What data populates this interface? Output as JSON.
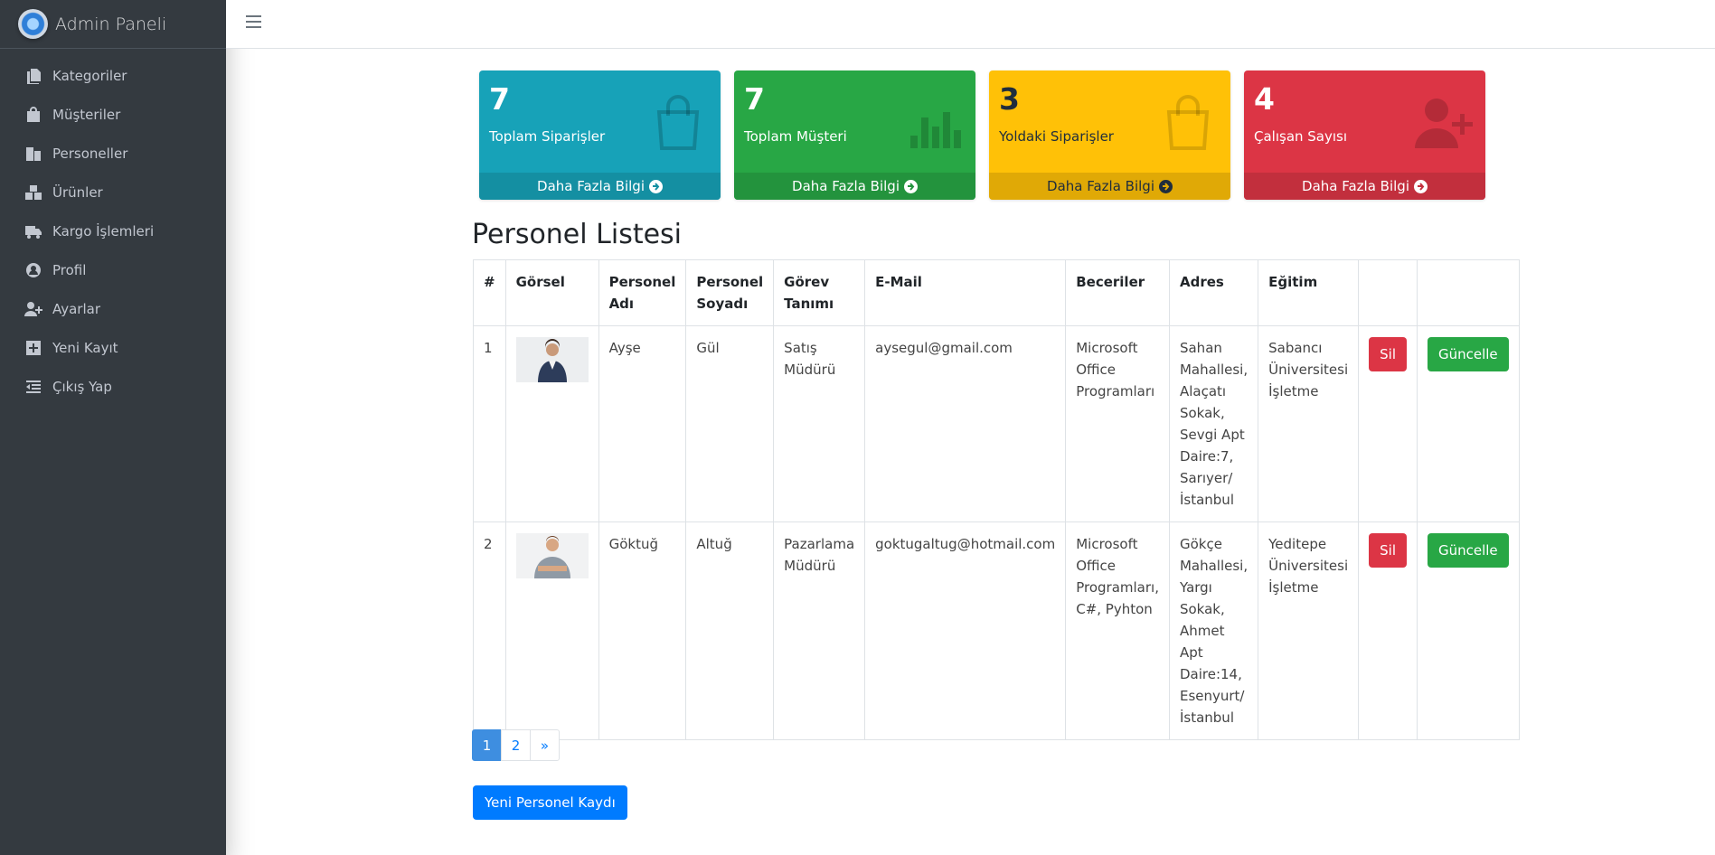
{
  "brand": {
    "title": "Admin Paneli"
  },
  "sidebar": {
    "items": [
      {
        "label": "Kategoriler",
        "icon": "copy-icon"
      },
      {
        "label": "Müşteriler",
        "icon": "shopping-bag-icon"
      },
      {
        "label": "Personeller",
        "icon": "building-icon"
      },
      {
        "label": "Ürünler",
        "icon": "boxes-icon"
      },
      {
        "label": "Kargo İşlemleri",
        "icon": "truck-icon"
      },
      {
        "label": "Profil",
        "icon": "user-circle-icon"
      },
      {
        "label": "Ayarlar",
        "icon": "user-plus-icon"
      },
      {
        "label": "Yeni Kayıt",
        "icon": "plus-square-icon"
      },
      {
        "label": "Çıkış Yap",
        "icon": "outdent-icon"
      }
    ]
  },
  "stats": [
    {
      "value": "7",
      "label": "Toplam Siparişler",
      "more": "Daha Fazla Bilgi",
      "color": "#17a2b8",
      "icon": "shopping-bag-icon"
    },
    {
      "value": "7",
      "label": "Toplam Müşteri",
      "more": "Daha Fazla Bilgi",
      "color": "#28a745",
      "icon": "bar-chart-icon"
    },
    {
      "value": "3",
      "label": "Yoldaki Siparişler",
      "more": "Daha Fazla Bilgi",
      "color": "#ffc107",
      "icon": "shopping-bag-icon"
    },
    {
      "value": "4",
      "label": "Çalışan Sayısı",
      "more": "Daha Fazla Bilgi",
      "color": "#dc3545",
      "icon": "user-plus-icon"
    }
  ],
  "list": {
    "title": "Personel Listesi",
    "headers": [
      "#",
      "Görsel",
      "Personel Adı",
      "Personel Soyadı",
      "Görev Tanımı",
      "E-Mail",
      "Beceriler",
      "Adres",
      "Eğitim",
      "",
      ""
    ],
    "rows": [
      {
        "no": "1",
        "name": "Ayşe",
        "surname": "Gül",
        "role": "Satış Müdürü",
        "email": "aysegul@gmail.com",
        "skills": "Microsoft Office Programları",
        "address": "Sahan Mahallesi, Alaçatı Sokak, Sevgi Apt Daire:7, Sarıyer/ İstanbul",
        "education": "Sabancı Üniversitesi İşletme",
        "delete": "Sil",
        "update": "Güncelle"
      },
      {
        "no": "2",
        "name": "Göktuğ",
        "surname": "Altuğ",
        "role": "Pazarlama Müdürü",
        "email": "goktugaltug@hotmail.com",
        "skills": "Microsoft Office Programları, C#, Pyhton",
        "address": "Gökçe Mahallesi, Yargı Sokak, Ahmet Apt Daire:14, Esenyurt/ İstanbul",
        "education": "Yeditepe Üniversitesi İşletme",
        "delete": "Sil",
        "update": "Güncelle"
      }
    ]
  },
  "pagination": {
    "pages": [
      "1",
      "2"
    ],
    "next": "»",
    "active": "1"
  },
  "actions": {
    "new_label": "Yeni Personel Kaydı"
  }
}
